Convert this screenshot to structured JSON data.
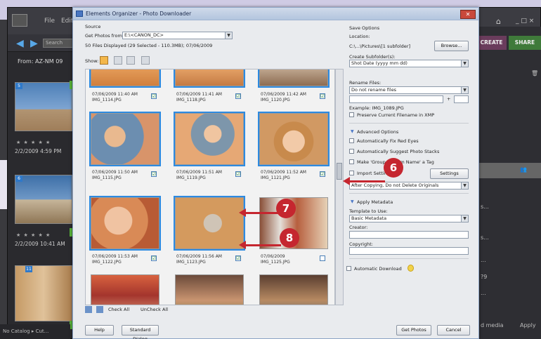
{
  "app": {
    "menu": [
      "File",
      "Edit"
    ],
    "search_placeholder": "Search",
    "from_label": "From: AZ-NM 09",
    "left_items": [
      {
        "badge": "5",
        "date": "2/2/2009 4:59 PM"
      },
      {
        "badge": "6",
        "date": "2/2/2009 10:41 AM"
      },
      {
        "badge": "11",
        "date": ""
      }
    ],
    "create_label": "CREATE",
    "share_label": "SHARE",
    "window_controls": "_ □ ×",
    "right_texts": [
      "s...",
      "s...",
      "...",
      "...",
      "?9"
    ],
    "bottom_left": "No Catalog ▸ Cut...",
    "bottom_right_media": "d media",
    "bottom_right_apply": "Apply"
  },
  "dialog": {
    "title": "Elements Organizer - Photo Downloader",
    "source_heading": "Source",
    "get_photos_label": "Get Photos from:",
    "get_photos_value": "E:\\<CANON_DC>",
    "info_line": "50 Files Displayed (29 Selected - 110.3MB); 07/06/2009",
    "show_label": "Show:",
    "check_all": "Check All",
    "uncheck_all": "UnCheck All",
    "help_button": "Help",
    "standard_dialog_button": "Standard Dialog",
    "get_photos_button": "Get Photos",
    "cancel_button": "Cancel",
    "save_options": {
      "heading": "Save Options",
      "location_label": "Location:",
      "location_value": "C:\\...\\Pictures\\[1 subfolder]",
      "browse_button": "Browse...",
      "create_subfolders_label": "Create Subfolder(s):",
      "create_subfolders_value": "Shot Date (yyyy mm dd)",
      "rename_files_label": "Rename Files:",
      "rename_files_value": "Do not rename files",
      "rename_plus": "+",
      "example_line": "Example: IMG_1089.JPG",
      "preserve_label": "Preserve Current Filename in XMP"
    },
    "advanced": {
      "heading": "Advanced Options",
      "auto_fix_label": "Automatically Fix Red Eyes",
      "suggest_stacks_label": "Automatically Suggest Photo Stacks",
      "make_group_label": "Make 'Group Custom Name' a Tag",
      "import_settings_label": "Import Settings",
      "settings_button": "Settings",
      "after_copying_value": "After Copying, Do not Delete Originals"
    },
    "metadata": {
      "heading": "Apply Metadata",
      "template_label": "Template to Use:",
      "template_value": "Basic Metadata",
      "creator_label": "Creator:",
      "copyright_label": "Copyright:"
    },
    "auto_download_label": "Automatic Download",
    "thumbnails": [
      {
        "date": "07/06/2009 11:40 AM",
        "file": "IMG_1114.JPG",
        "checked": "☑"
      },
      {
        "date": "07/06/2009 11:41 AM",
        "file": "IMG_1118.JPG",
        "checked": "☑"
      },
      {
        "date": "07/06/2009 11:42 AM",
        "file": "IMG_1120.JPG",
        "checked": "☑"
      },
      {
        "date": "07/06/2009 11:50 AM",
        "file": "IMG_1115.JPG",
        "checked": "☑"
      },
      {
        "date": "07/06/2009 11:51 AM",
        "file": "IMG_1119.JPG",
        "checked": "☑"
      },
      {
        "date": "07/06/2009 11:52 AM",
        "file": "IMG_1121.JPG",
        "checked": "☑"
      },
      {
        "date": "07/06/2009 11:53 AM",
        "file": "IMG_1122.JPG",
        "checked": "☑"
      },
      {
        "date": "07/06/2009 11:56 AM",
        "file": "IMG_1123.JPG",
        "checked": "☑"
      },
      {
        "date": "07/06/2009",
        "file": "IMG_1125.JPG",
        "checked": ""
      }
    ]
  },
  "callouts": [
    "6",
    "7",
    "8"
  ]
}
